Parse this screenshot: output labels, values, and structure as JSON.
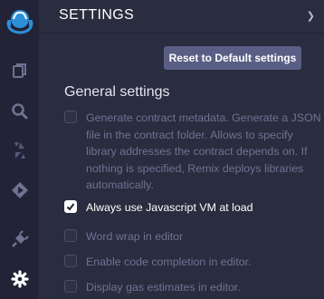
{
  "header": {
    "title": "SETTINGS"
  },
  "sidebar": {
    "icons": [
      {
        "name": "remix-logo-icon"
      },
      {
        "name": "file-explorer-icon"
      },
      {
        "name": "search-icon"
      },
      {
        "name": "solidity-compiler-icon"
      },
      {
        "name": "deploy-run-icon"
      },
      {
        "name": "plugin-manager-icon"
      },
      {
        "name": "settings-gear-icon"
      }
    ],
    "colors": {
      "accent": "#2c8fd8",
      "icon": "#6e7392",
      "active_icon": "#ffffff"
    }
  },
  "toolbar": {
    "reset_label": "Reset to Default settings"
  },
  "general": {
    "title": "General settings",
    "options": [
      {
        "label": "Generate contract metadata. Generate a JSON file in the contract folder. Allows to specify library addresses the contract depends on. If nothing is specified, Remix deploys libraries automatically.",
        "checked": false
      },
      {
        "label": "Always use Javascript VM at load",
        "checked": true
      },
      {
        "label": "Word wrap in editor",
        "checked": false
      },
      {
        "label": "Enable code completion in editor.",
        "checked": false
      },
      {
        "label": "Display gas estimates in editor.",
        "checked": false
      }
    ]
  }
}
